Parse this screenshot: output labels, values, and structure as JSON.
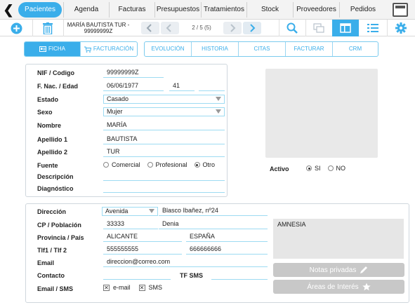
{
  "nav": {
    "tabs": [
      "Pacientes",
      "Agenda",
      "Facturas",
      "Presupuestos",
      "Tratamientos",
      "Stock",
      "Proveedores",
      "Pedidos"
    ],
    "active": "Pacientes"
  },
  "toolbar": {
    "record_name_line1": "MARÍA BAUTISTA TUR -",
    "record_name_line2": "99999999Z",
    "pager": "2 / 5 (5)"
  },
  "subtabs": {
    "left": [
      {
        "label": "FICHA",
        "icon": "id-card-icon",
        "active": true
      },
      {
        "label": "FACTURACIÓN",
        "icon": "cart-icon",
        "active": false
      }
    ],
    "right": [
      "EVOLUCIÓN",
      "HISTORIA",
      "CITAS",
      "FACTURAR",
      "CRM"
    ]
  },
  "patient": {
    "labels": {
      "nif": "NIF / Codigo",
      "fnac": "F. Nac. / Edad",
      "estado": "Estado",
      "sexo": "Sexo",
      "nombre": "Nombre",
      "apellido1": "Apellido 1",
      "apellido2": "Apellido 2",
      "fuente": "Fuente",
      "descripcion": "Descripción",
      "diagnostico": "Diagnóstico"
    },
    "nif": "99999999Z",
    "fnac": "06/06/1977",
    "edad": "41",
    "estado": "Casado",
    "sexo": "Mujer",
    "nombre": "MARÍA",
    "apellido1": "BAUTISTA",
    "apellido2": "TUR",
    "fuente_options": [
      "Comercial",
      "Profesional",
      "Otro"
    ],
    "fuente_selected": "Otro",
    "descripcion": "",
    "diagnostico": ""
  },
  "activo": {
    "label": "Activo",
    "options": [
      "SI",
      "NO"
    ],
    "selected": "SI"
  },
  "address": {
    "labels": {
      "direccion": "Dirección",
      "cp": "CP / Población",
      "provincia": "Provincia / País",
      "tlf": "Tlf1 / Tlf 2",
      "email": "Email",
      "contacto": "Contacto",
      "tfsms": "TF SMS",
      "emailsms": "Email / SMS"
    },
    "via_type": "Avenida",
    "street": "Blasco Ibañez, nº24",
    "cp": "33333",
    "poblacion": "Denia",
    "provincia": "ALICANTE",
    "pais": "ESPAÑA",
    "tlf1": "555555555",
    "tlf2": "666666666",
    "email": "direccion@correo.com",
    "contacto": "",
    "tfsms": "",
    "checks": [
      {
        "label": "e-mail",
        "checked": true
      },
      {
        "label": "SMS",
        "checked": true
      }
    ]
  },
  "side": {
    "notes": "AMNESIA",
    "notas_btn": "Notas privadas",
    "areas_btn": "Áreas de Interés"
  },
  "colors": {
    "accent": "#3aaeea",
    "field_line": "#9ddbf2"
  }
}
